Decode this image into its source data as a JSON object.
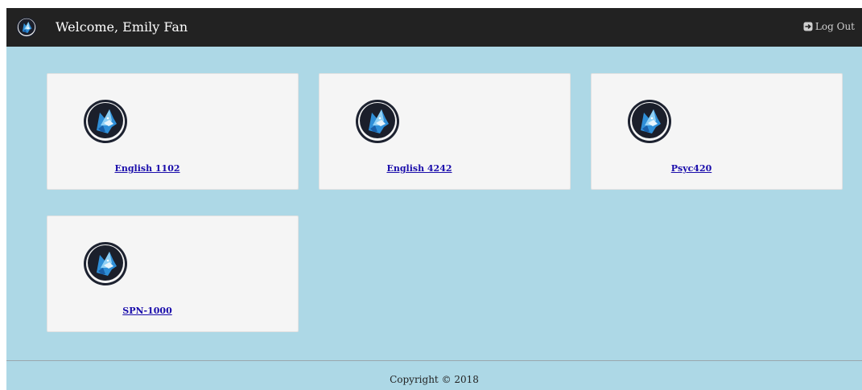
{
  "navbar": {
    "logo_icon": "wolf-logo-icon",
    "welcome": "Welcome, Emily Fan",
    "logout_label": "Log Out",
    "logout_icon": "sign-out-icon"
  },
  "courses": [
    {
      "label": "English 1102",
      "icon": "wolf-logo-icon"
    },
    {
      "label": "English 4242",
      "icon": "wolf-logo-icon"
    },
    {
      "label": "Psyc420",
      "icon": "wolf-logo-icon"
    },
    {
      "label": "SPN-1000",
      "icon": "wolf-logo-icon"
    }
  ],
  "footer": {
    "copyright": "Copyright © 2018"
  },
  "colors": {
    "navbar_bg": "#222222",
    "page_bg": "#add8e6",
    "card_bg": "#f5f5f5",
    "link": "#1a0dab"
  }
}
